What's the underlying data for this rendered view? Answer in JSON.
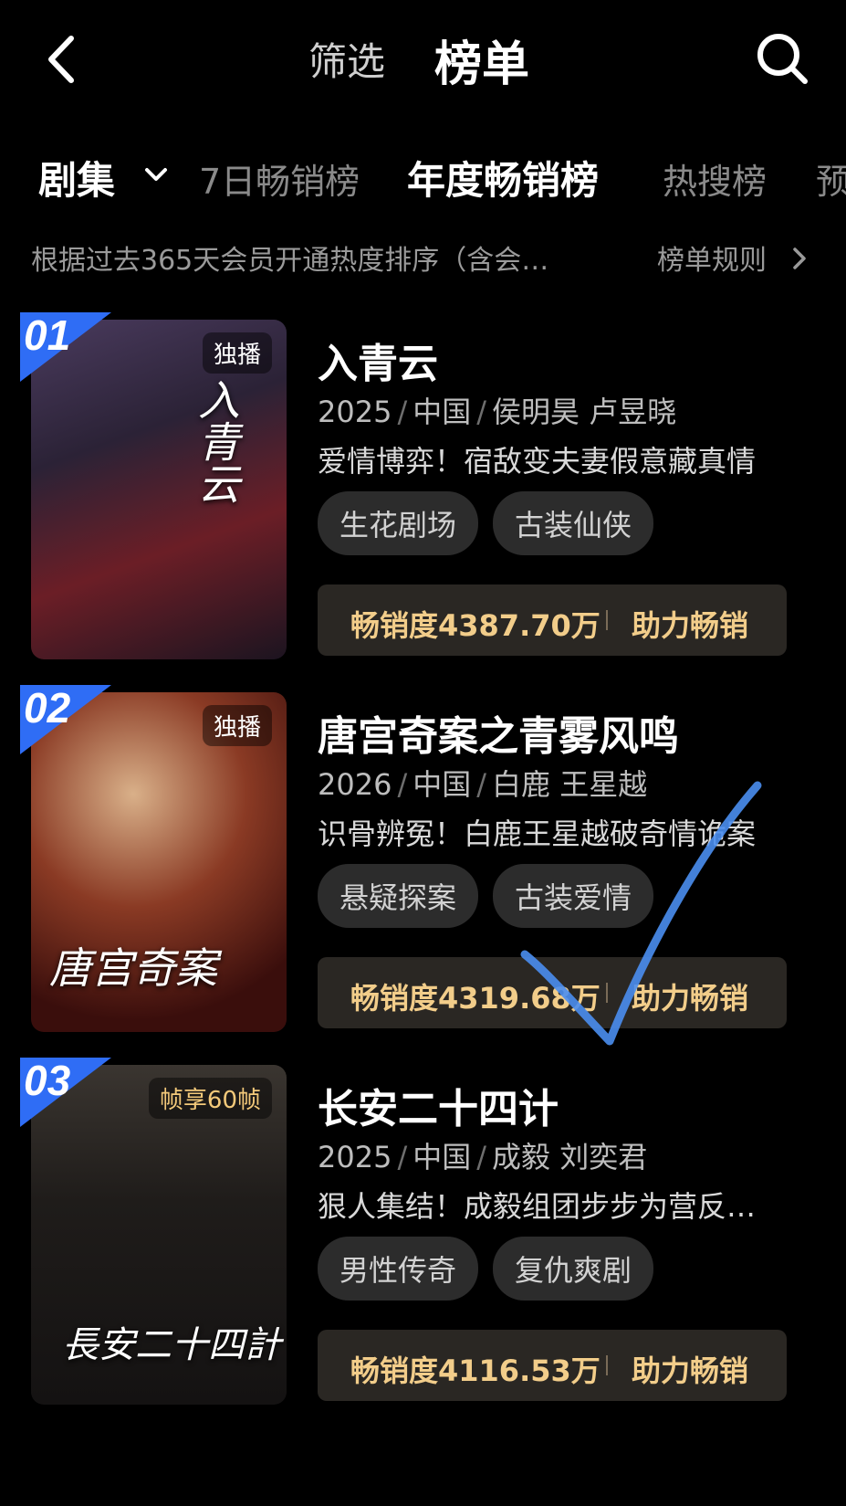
{
  "header": {
    "back_icon": "chevron-left-icon",
    "tab_filter": "筛选",
    "tab_rank": "榜单",
    "search_icon": "search-icon"
  },
  "category_bar": {
    "selected": "剧集",
    "tabs": [
      "7日畅销榜",
      "年度畅销榜",
      "热搜榜",
      "预"
    ],
    "active_tab": "年度畅销榜"
  },
  "description": {
    "text": "根据过去365天会员开通热度排序（含会…",
    "rules_link": "榜单规则"
  },
  "items": [
    {
      "rank": "01",
      "badge": "独播",
      "poster_art": "入青云",
      "title": "入青云",
      "year": "2025",
      "region": "中国",
      "cast": "侯明昊 卢昱晓",
      "tagline": "爱情博弈！宿敌变夫妻假意藏真情",
      "tags": [
        "生花剧场",
        "古装仙侠"
      ],
      "sales": "畅销度4387.70万",
      "boost": "助力畅销"
    },
    {
      "rank": "02",
      "badge": "独播",
      "poster_art": "唐宫奇案",
      "title": "唐宫奇案之青雾风鸣",
      "year": "2026",
      "region": "中国",
      "cast": "白鹿 王星越",
      "tagline": "识骨辨冤！白鹿王星越破奇情诡案",
      "tags": [
        "悬疑探案",
        "古装爱情"
      ],
      "sales": "畅销度4319.68万",
      "boost": "助力畅销"
    },
    {
      "rank": "03",
      "badge": "帧享60帧",
      "poster_art": "長安二十四計",
      "title": "长安二十四计",
      "year": "2025",
      "region": "中国",
      "cast": "成毅 刘奕君",
      "tagline": "狠人集结！成毅组团步步为营反…",
      "tags": [
        "男性传奇",
        "复仇爽剧"
      ],
      "sales": "畅销度4116.53万",
      "boost": "助力畅销"
    }
  ],
  "colors": {
    "background": "#000000",
    "accent_gold": "#f2cd8a",
    "rank_blue": "#2f6df5",
    "annotation_blue": "#4a8ef0"
  }
}
